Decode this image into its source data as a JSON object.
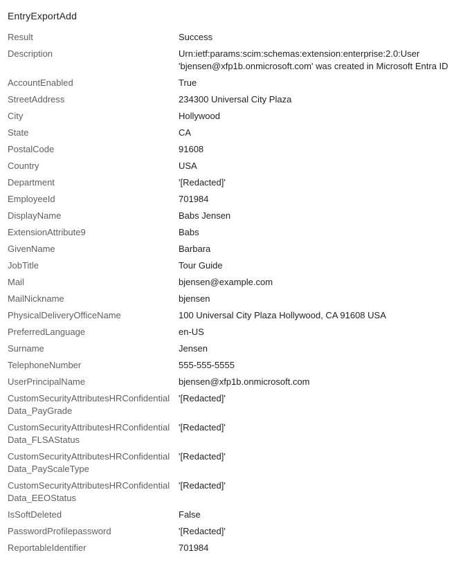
{
  "panel": {
    "title": "EntryExportAdd"
  },
  "details": [
    {
      "label": "Result",
      "value": "Success"
    },
    {
      "label": "Description",
      "value": "Urn:ietf:params:scim:schemas:extension:enterprise:2.0:User 'bjensen@xfp1b.onmicrosoft.com' was created in Microsoft Entra ID"
    },
    {
      "label": "AccountEnabled",
      "value": "True"
    },
    {
      "label": "StreetAddress",
      "value": "234300 Universal City Plaza"
    },
    {
      "label": "City",
      "value": "Hollywood"
    },
    {
      "label": "State",
      "value": "CA"
    },
    {
      "label": "PostalCode",
      "value": "91608"
    },
    {
      "label": "Country",
      "value": "USA"
    },
    {
      "label": "Department",
      "value": "'[Redacted]'"
    },
    {
      "label": "EmployeeId",
      "value": "701984"
    },
    {
      "label": "DisplayName",
      "value": "Babs Jensen"
    },
    {
      "label": "ExtensionAttribute9",
      "value": "Babs"
    },
    {
      "label": "GivenName",
      "value": "Barbara"
    },
    {
      "label": "JobTitle",
      "value": "Tour Guide"
    },
    {
      "label": "Mail",
      "value": "bjensen@example.com"
    },
    {
      "label": "MailNickname",
      "value": "bjensen"
    },
    {
      "label": "PhysicalDeliveryOfficeName",
      "value": "100 Universal City Plaza Hollywood, CA 91608 USA"
    },
    {
      "label": "PreferredLanguage",
      "value": "en-US"
    },
    {
      "label": "Surname",
      "value": "Jensen"
    },
    {
      "label": "TelephoneNumber",
      "value": "555-555-5555"
    },
    {
      "label": "UserPrincipalName",
      "value": "bjensen@xfp1b.onmicrosoft.com"
    },
    {
      "label": "CustomSecurityAttributesHRConfidentialData_PayGrade",
      "value": "'[Redacted]'"
    },
    {
      "label": "CustomSecurityAttributesHRConfidentialData_FLSAStatus",
      "value": "'[Redacted]'"
    },
    {
      "label": "CustomSecurityAttributesHRConfidentialData_PayScaleType",
      "value": "'[Redacted]'"
    },
    {
      "label": "CustomSecurityAttributesHRConfidentialData_EEOStatus",
      "value": "'[Redacted]'"
    },
    {
      "label": "IsSoftDeleted",
      "value": "False"
    },
    {
      "label": "PasswordProfilepassword",
      "value": "'[Redacted]'"
    },
    {
      "label": "ReportableIdentifier",
      "value": "701984"
    }
  ],
  "colors": {
    "label": "#605e5c",
    "value": "#201f1e",
    "background": "#ffffff"
  }
}
